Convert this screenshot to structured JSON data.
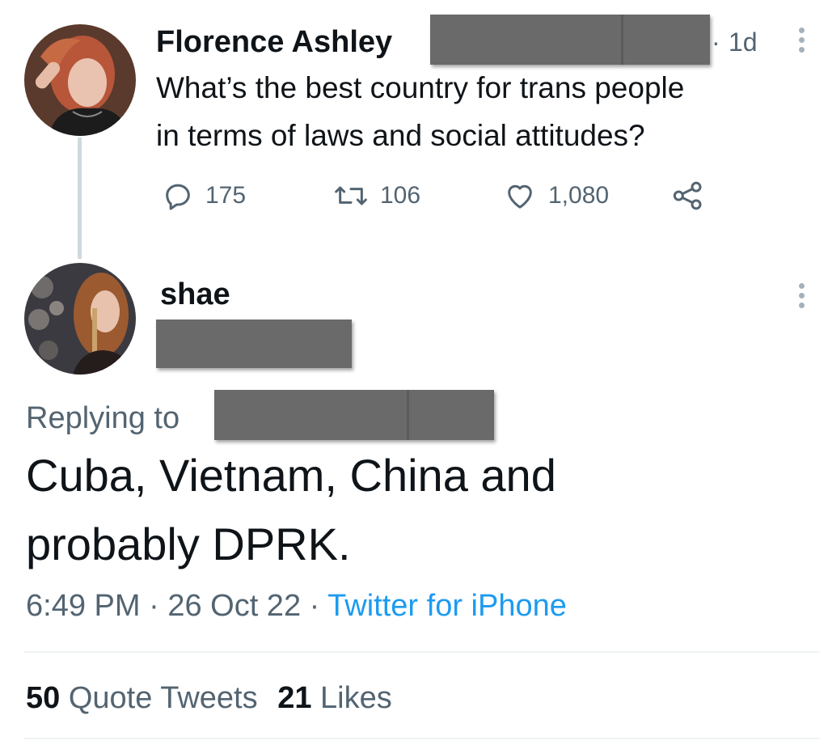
{
  "tweet1": {
    "author": "Florence Ashley",
    "time": "1d",
    "separator": "·",
    "text_line1": "What’s the best country for trans people",
    "text_line2": "in terms of laws and social attitudes?",
    "actions": {
      "replies": "175",
      "retweets": "106",
      "likes": "1,080"
    }
  },
  "tweet2": {
    "author": "shae",
    "replying_to_label": "Replying to",
    "text_line1": "Cuba, Vietnam, China and",
    "text_line2": "probably DPRK.",
    "time": "6:49 PM",
    "date": "26 Oct 22",
    "separator1": "·",
    "separator2": "·",
    "source": "Twitter for iPhone",
    "stats": {
      "quote_count": "50",
      "quote_label": "Quote Tweets",
      "likes_count": "21",
      "likes_label": "Likes"
    }
  },
  "colors": {
    "link": "#1d9bf0",
    "muted": "#536471",
    "redaction": "#6a6a6a"
  }
}
